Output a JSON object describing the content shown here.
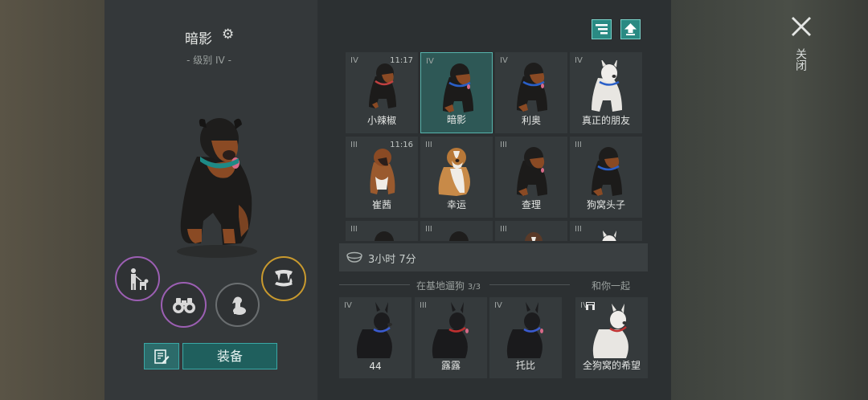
{
  "dog": {
    "name": "暗影",
    "level": "- 级别 IV -"
  },
  "actions": {
    "equip_label": "装备"
  },
  "grid": [
    {
      "tier": "IV",
      "time": "11:17",
      "name": "小辣椒",
      "coat": "rottweiler",
      "selected": false
    },
    {
      "tier": "IV",
      "time": "",
      "name": "暗影",
      "coat": "rottweiler",
      "selected": true
    },
    {
      "tier": "IV",
      "time": "",
      "name": "利奥",
      "coat": "rottweiler",
      "selected": false
    },
    {
      "tier": "IV",
      "time": "",
      "name": "真正的朋友",
      "coat": "white",
      "selected": false
    },
    {
      "tier": "III",
      "time": "11:16",
      "name": "崔茜",
      "coat": "boxer",
      "selected": false
    },
    {
      "tier": "III",
      "time": "",
      "name": "幸运",
      "coat": "stbernard",
      "selected": false
    },
    {
      "tier": "III",
      "time": "",
      "name": "查理",
      "coat": "rottweiler",
      "selected": false
    },
    {
      "tier": "III",
      "time": "",
      "name": "狗窝头子",
      "coat": "rottweiler",
      "selected": false
    },
    {
      "tier": "III",
      "time": "",
      "name": "",
      "coat": "rottweiler",
      "selected": false
    },
    {
      "tier": "III",
      "time": "",
      "name": "",
      "coat": "rottweiler",
      "selected": false
    },
    {
      "tier": "III",
      "time": "",
      "name": "",
      "coat": "mixed",
      "selected": false
    },
    {
      "tier": "III",
      "time": "",
      "name": "",
      "coat": "white",
      "selected": false
    }
  ],
  "timer": {
    "text": "3小时 7分"
  },
  "base": {
    "label": "在基地遛狗",
    "count": "3/3",
    "dogs": [
      {
        "tier": "IV",
        "name": "44",
        "collar": "#3a5bd0"
      },
      {
        "tier": "III",
        "name": "露露",
        "collar": "#c03030"
      },
      {
        "tier": "IV",
        "name": "托比",
        "collar": "#3a5bd0"
      }
    ]
  },
  "with_you": {
    "label": "和你一起",
    "dog": {
      "tier": "IV",
      "name": "全狗窝的希望"
    }
  },
  "close": {
    "label": "关闭"
  },
  "colors": {
    "accent_teal": "#2a8a83",
    "ability_purple": "#9c5fb3",
    "ability_gold": "#c99a2e",
    "selection_border": "#56b3ac"
  }
}
